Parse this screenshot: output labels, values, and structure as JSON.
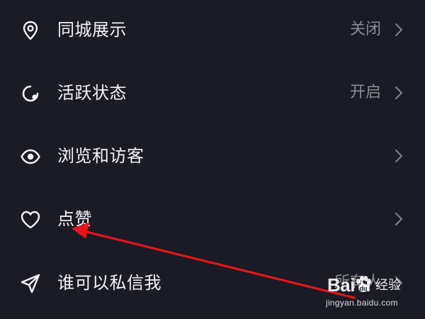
{
  "settings": {
    "items": [
      {
        "label": "同城展示",
        "value": "关闭",
        "icon": "location-pin-icon"
      },
      {
        "label": "活跃状态",
        "value": "开启",
        "icon": "active-status-icon"
      },
      {
        "label": "浏览和访客",
        "value": "",
        "icon": "eye-icon"
      },
      {
        "label": "点赞",
        "value": "",
        "icon": "heart-icon"
      },
      {
        "label": "谁可以私信我",
        "value": "所有人",
        "icon": "send-icon"
      }
    ]
  },
  "annotation": {
    "arrow_color": "#e8141b"
  },
  "watermark": {
    "logo": "Bai  u",
    "paw_icon": "baidu-paw-icon",
    "text": "经验",
    "url": "jingyan.baidu.com"
  },
  "colors": {
    "background": "#1a1b24",
    "label": "#f3f3f5",
    "value": "#8a8b93",
    "chevron": "#7d7e86"
  }
}
